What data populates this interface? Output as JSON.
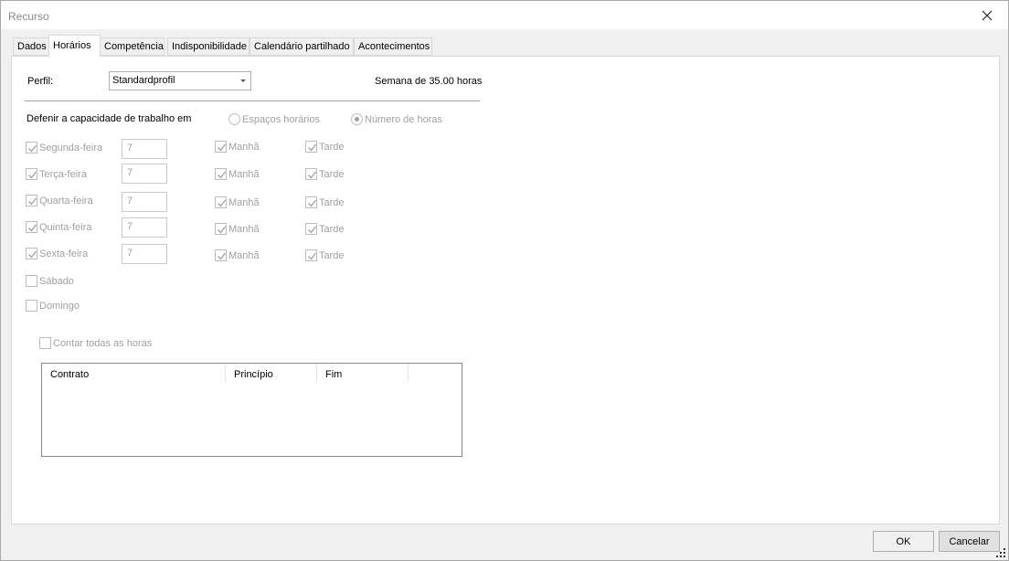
{
  "window": {
    "title": "Recurso"
  },
  "tabs": [
    {
      "label": "Dados"
    },
    {
      "label": "Horários"
    },
    {
      "label": "Competência"
    },
    {
      "label": "Indisponibilidade"
    },
    {
      "label": "Calendário partilhado"
    },
    {
      "label": "Acontecimentos"
    }
  ],
  "active_tab": "Horários",
  "profile": {
    "label": "Perfil:",
    "value": "Standardprofil",
    "week_summary": "Semana de 35.00 horas"
  },
  "capacity": {
    "label": "Defenir a capacidade de trabalho em",
    "options": [
      {
        "label": "Espaços horários",
        "selected": false
      },
      {
        "label": "Número de horas",
        "selected": true
      }
    ]
  },
  "days": [
    {
      "label": "Segunda-feira",
      "checked": true,
      "hours": "7",
      "morning_label": "Manhã",
      "afternoon_label": "Tarde"
    },
    {
      "label": "Terça-feira",
      "checked": true,
      "hours": "7",
      "morning_label": "Manhã",
      "afternoon_label": "Tarde"
    },
    {
      "label": "Quarta-feira",
      "checked": true,
      "hours": "7",
      "morning_label": "Manhã",
      "afternoon_label": "Tarde"
    },
    {
      "label": "Quinta-feira",
      "checked": true,
      "hours": "7",
      "morning_label": "Manhã",
      "afternoon_label": "Tarde"
    },
    {
      "label": "Sexta-feira",
      "checked": true,
      "hours": "7",
      "morning_label": "Manhã",
      "afternoon_label": "Tarde"
    },
    {
      "label": "Sábado",
      "checked": false
    },
    {
      "label": "Domingo",
      "checked": false
    }
  ],
  "count_all_hours": {
    "label": "Contar todas as horas",
    "checked": false
  },
  "contracts_table": {
    "columns": [
      "Contrato",
      "Princípio",
      "Fim",
      ""
    ],
    "rows": []
  },
  "buttons": {
    "ok": "OK",
    "cancel": "Cancelar"
  },
  "colors": {
    "disabled_text": "#a0a0a0",
    "window_bg": "#f0f0f0",
    "panel_bg": "#ffffff"
  }
}
